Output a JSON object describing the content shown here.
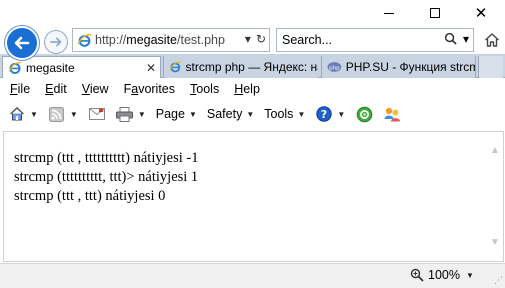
{
  "window": {
    "minimize_icon": "minimize-icon",
    "maximize_icon": "maximize-icon",
    "close_glyph": "✕"
  },
  "nav": {
    "url_prefix": "http://",
    "url_host": "megasite",
    "url_path": "/test.php",
    "search_placeholder": "Search...",
    "compat_glyph": "▾",
    "refresh_glyph": "↻",
    "search_glyph": "⌕",
    "search_caret": "▾"
  },
  "tabs": [
    {
      "label": "megasite",
      "active": true,
      "close": "✕"
    },
    {
      "label": "strcmp php — Яндекс: на...",
      "active": false
    },
    {
      "label": "PHP.SU - Функция strcmp",
      "active": false
    }
  ],
  "menu": {
    "items": [
      {
        "label": "File",
        "accel": "F",
        "rest": "ile"
      },
      {
        "label": "Edit",
        "accel": "E",
        "rest": "dit"
      },
      {
        "label": "View",
        "accel": "V",
        "rest": "iew"
      },
      {
        "label": "Favorites",
        "accel": "a",
        "pre": "F",
        "rest": "vorites"
      },
      {
        "label": "Tools",
        "accel": "T",
        "rest": "ools"
      },
      {
        "label": "Help",
        "accel": "H",
        "rest": "elp"
      }
    ]
  },
  "commands": {
    "page": "Page",
    "safety": "Safety",
    "tools": "Tools",
    "help_glyph": "?"
  },
  "content": {
    "lines": [
      "strcmp (ttt , tttttttttt) nátiyjesi -1",
      "strcmp (tttttttttt, ttt)> nátiyjesi 1",
      "strcmp (ttt , ttt) nátiyjesi 0"
    ]
  },
  "status": {
    "zoom": "100%"
  },
  "colors": {
    "accent": "#1a6fd4",
    "tab_strip": "#c9d4e3"
  }
}
